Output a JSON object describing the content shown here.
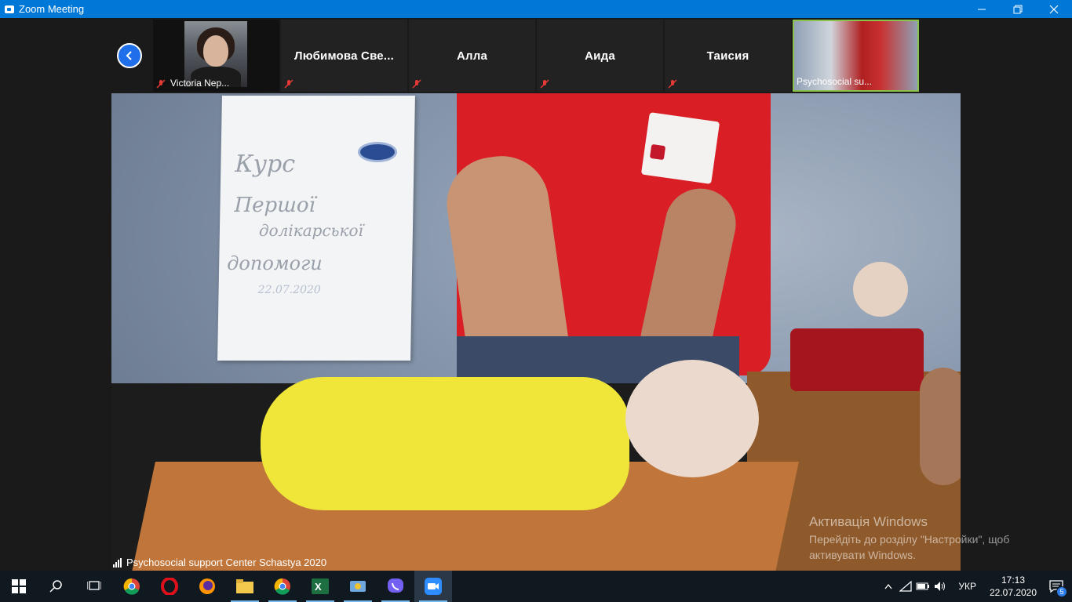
{
  "window": {
    "title": "Zoom Meeting"
  },
  "participants": [
    {
      "name": "Victoria Nep...",
      "has_video": true,
      "muted": true
    },
    {
      "name": "Любимова  Све...",
      "has_video": false,
      "muted": true
    },
    {
      "name": "Алла",
      "has_video": false,
      "muted": true
    },
    {
      "name": "Аида",
      "has_video": false,
      "muted": true
    },
    {
      "name": "Таисия",
      "has_video": false,
      "muted": true
    },
    {
      "name": "Psychosocial su...",
      "has_video": true,
      "muted": false,
      "active_speaker": true
    }
  ],
  "main_video": {
    "speaker_name": "Psychosocial support Center Schastya 2020",
    "board_text": [
      "Курс",
      "Першої",
      "долікарської",
      "допомоги",
      "22.07.2020"
    ]
  },
  "activation_watermark": {
    "line1": "Активація Windows",
    "line2": "Перейдіть до розділу \"Настройки\", щоб",
    "line3": "активувати Windows."
  },
  "taskbar": {
    "apps": [
      "start",
      "search",
      "task-view",
      "chrome",
      "opera",
      "firefox",
      "file-explorer",
      "chrome-profile",
      "excel",
      "control-panel",
      "viber",
      "zoom"
    ],
    "language": "УКР",
    "time": "17:13",
    "date": "22.07.2020",
    "notification_count": "5"
  },
  "colors": {
    "titlebar": "#0078d7",
    "active_border": "#8bc34a",
    "accent": "#1f6fea"
  }
}
